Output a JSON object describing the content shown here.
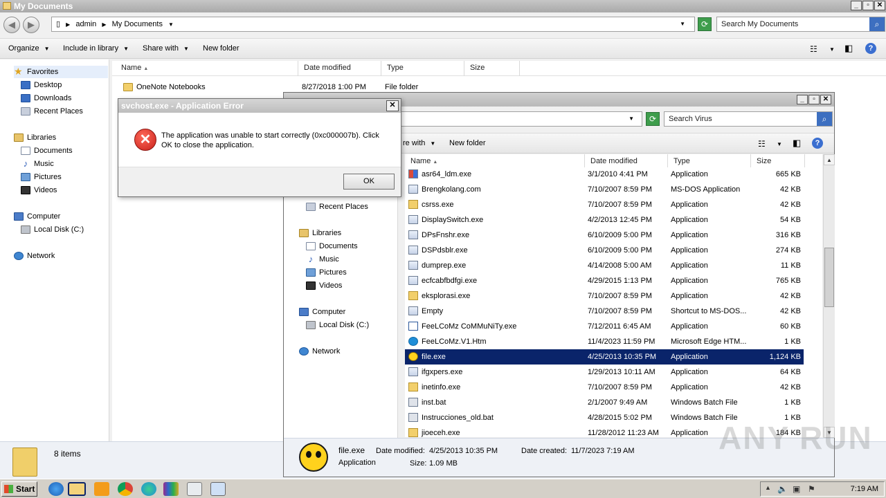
{
  "window_main": {
    "title": "My Documents",
    "breadcrumb": [
      "admin",
      "My Documents"
    ],
    "search_placeholder": "Search My Documents",
    "toolbar": {
      "organize": "Organize",
      "include_in_library": "Include in library",
      "share_with": "Share with",
      "new_folder": "New folder"
    },
    "nav": {
      "favorites": "Favorites",
      "desktop": "Desktop",
      "downloads": "Downloads",
      "recent_places": "Recent Places",
      "libraries": "Libraries",
      "documents": "Documents",
      "music": "Music",
      "pictures": "Pictures",
      "videos": "Videos",
      "computer": "Computer",
      "local_disk": "Local Disk (C:)",
      "network": "Network"
    },
    "columns": {
      "name": "Name",
      "date_modified": "Date modified",
      "type": "Type",
      "size": "Size"
    },
    "rows": [
      {
        "name": "OneNote Notebooks",
        "date": "8/27/2018 1:00 PM",
        "type": "File folder"
      }
    ],
    "status_count": "8 items"
  },
  "window_second": {
    "search_placeholder": "Search Virus",
    "toolbar": {
      "share_with_partial": "re with",
      "new_folder": "New folder"
    },
    "nav": {
      "recent_places": "Recent Places",
      "libraries": "Libraries",
      "documents": "Documents",
      "music": "Music",
      "pictures": "Pictures",
      "videos": "Videos",
      "computer": "Computer",
      "local_disk": "Local Disk (C:)",
      "network": "Network"
    },
    "columns": {
      "name": "Name",
      "date_modified": "Date modified",
      "type": "Type",
      "size": "Size"
    },
    "files": [
      {
        "name": "asr64_ldm.exe",
        "date": "3/1/2010 4:41 PM",
        "type": "Application",
        "size": "665 KB",
        "icon": "shield-icon"
      },
      {
        "name": "Brengkolang.com",
        "date": "7/10/2007 8:59 PM",
        "type": "MS-DOS Application",
        "size": "42 KB",
        "icon": "app-icon"
      },
      {
        "name": "csrss.exe",
        "date": "7/10/2007 8:59 PM",
        "type": "Application",
        "size": "42 KB",
        "icon": "folder-icon"
      },
      {
        "name": "DisplaySwitch.exe",
        "date": "4/2/2013 12:45 PM",
        "type": "Application",
        "size": "54 KB",
        "icon": "app-icon"
      },
      {
        "name": "DPsFnshr.exe",
        "date": "6/10/2009 5:00 PM",
        "type": "Application",
        "size": "316 KB",
        "icon": "app-icon"
      },
      {
        "name": "DSPdsblr.exe",
        "date": "6/10/2009 5:00 PM",
        "type": "Application",
        "size": "274 KB",
        "icon": "app-icon"
      },
      {
        "name": "dumprep.exe",
        "date": "4/14/2008 5:00 AM",
        "type": "Application",
        "size": "11 KB",
        "icon": "app-icon"
      },
      {
        "name": "ecfcabfbdfgi.exe",
        "date": "4/29/2015 1:13 PM",
        "type": "Application",
        "size": "765 KB",
        "icon": "app-icon"
      },
      {
        "name": "eksplorasi.exe",
        "date": "7/10/2007 8:59 PM",
        "type": "Application",
        "size": "42 KB",
        "icon": "folder-icon"
      },
      {
        "name": "Empty",
        "date": "7/10/2007 8:59 PM",
        "type": "Shortcut to MS-DOS...",
        "size": "42 KB",
        "icon": "app-icon"
      },
      {
        "name": "FeeLCoMz CoMMuNiTy.exe",
        "date": "7/12/2011 6:45 AM",
        "type": "Application",
        "size": "60 KB",
        "icon": "word-icon"
      },
      {
        "name": "FeeLCoMz.V1.Htm",
        "date": "11/4/2023 11:59 PM",
        "type": "Microsoft Edge HTM...",
        "size": "1 KB",
        "icon": "edge-icon"
      },
      {
        "name": "file.exe",
        "date": "4/25/2013 10:35 PM",
        "type": "Application",
        "size": "1,124 KB",
        "icon": "ladybug-icon"
      },
      {
        "name": "ifgxpers.exe",
        "date": "1/29/2013 10:11 AM",
        "type": "Application",
        "size": "64 KB",
        "icon": "app-icon"
      },
      {
        "name": "inetinfo.exe",
        "date": "7/10/2007 8:59 PM",
        "type": "Application",
        "size": "42 KB",
        "icon": "folder-icon"
      },
      {
        "name": "inst.bat",
        "date": "2/1/2007 9:49 AM",
        "type": "Windows Batch File",
        "size": "1 KB",
        "icon": "batch-icon"
      },
      {
        "name": "Instrucciones_old.bat",
        "date": "4/28/2015 5:02 PM",
        "type": "Windows Batch File",
        "size": "1 KB",
        "icon": "batch-icon"
      },
      {
        "name": "jioeceh.exe",
        "date": "11/28/2012 11:23 AM",
        "type": "Application",
        "size": "184 KB",
        "icon": "folder-icon"
      }
    ],
    "selected_index": 12,
    "details": {
      "name": "file.exe",
      "type": "Application",
      "date_modified_label": "Date modified:",
      "date_modified": "4/25/2013 10:35 PM",
      "date_created_label": "Date created:",
      "date_created": "11/7/2023 7:19 AM",
      "size_label": "Size:",
      "size": "1.09 MB"
    }
  },
  "dialog": {
    "title": "svchost.exe - Application Error",
    "message": "The application was unable to start correctly (0xc000007b). Click OK to close the application.",
    "ok": "OK"
  },
  "taskbar": {
    "start": "Start",
    "clock": "7:19 AM"
  },
  "watermark": "ANY RUN"
}
